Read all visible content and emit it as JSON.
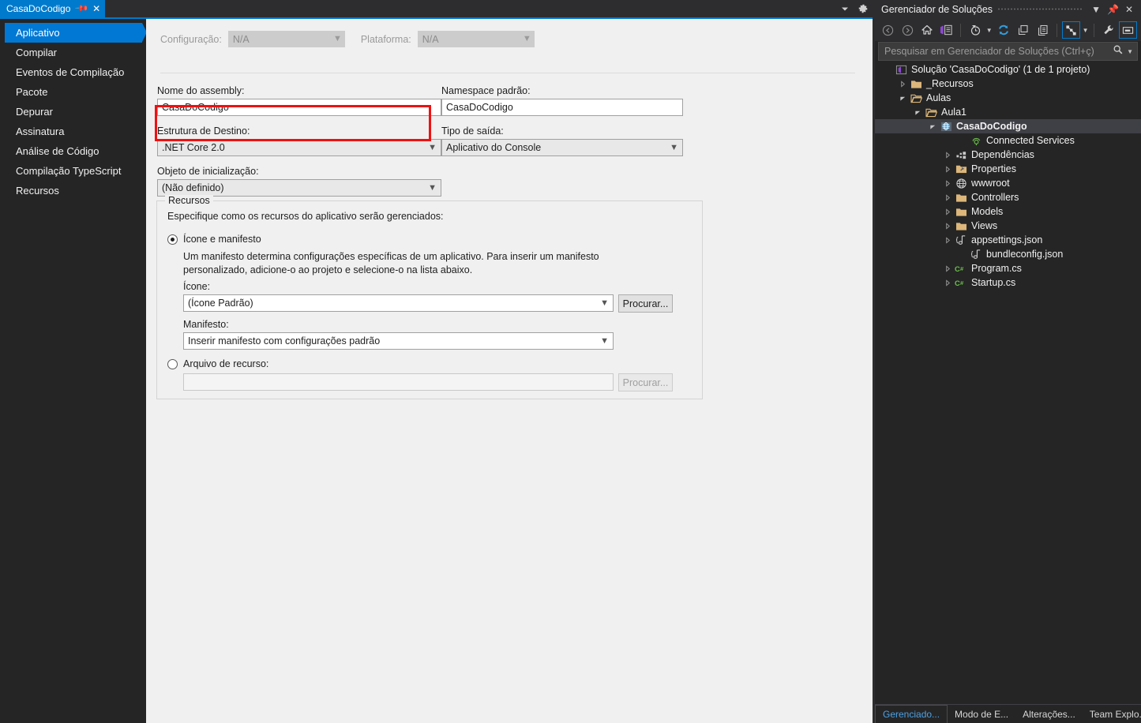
{
  "tab": {
    "label": "CasaDoCodigo",
    "pin_icon": "pin-icon",
    "close_icon": "close-icon",
    "dropdown_icon": "chevron-down-icon",
    "gear_icon": "gear-icon"
  },
  "nav": {
    "items": [
      {
        "label": "Aplicativo",
        "selected": true
      },
      {
        "label": "Compilar",
        "selected": false
      },
      {
        "label": "Eventos de Compilação",
        "selected": false
      },
      {
        "label": "Pacote",
        "selected": false
      },
      {
        "label": "Depurar",
        "selected": false
      },
      {
        "label": "Assinatura",
        "selected": false
      },
      {
        "label": "Análise de Código",
        "selected": false
      },
      {
        "label": "Compilação TypeScript",
        "selected": false
      },
      {
        "label": "Recursos",
        "selected": false
      }
    ]
  },
  "form": {
    "configuration_label": "Configuração:",
    "configuration_value": "N/A",
    "platform_label": "Plataforma:",
    "platform_value": "N/A",
    "assembly_name_label": "Nome do assembly:",
    "assembly_name_value": "CasaDoCodigo",
    "default_namespace_label": "Namespace padrão:",
    "default_namespace_value": "CasaDoCodigo",
    "target_framework_label": "Estrutura de Destino:",
    "target_framework_value": ".NET Core 2.0",
    "output_type_label": "Tipo de saída:",
    "output_type_value": "Aplicativo do Console",
    "startup_object_label": "Objeto de inicialização:",
    "startup_object_value": "(Não definido)",
    "highlight_color": "#ee1111"
  },
  "resources": {
    "group_title": "Recursos",
    "description": "Especifique como os recursos do aplicativo serão gerenciados:",
    "option_icon_manifest": "Ícone e manifesto",
    "option_icon_manifest_selected": true,
    "manifest_help_line1": "Um manifesto determina configurações específicas de um aplicativo. Para inserir um manifesto",
    "manifest_help_line2": "personalizado, adicione-o ao projeto e selecione-o na lista abaixo.",
    "icon_label": "Ícone:",
    "icon_value": "(Ícone Padrão)",
    "icon_browse_button": "Procurar...",
    "manifest_label": "Manifesto:",
    "manifest_value": "Inserir manifesto com configurações padrão",
    "option_resource_file": "Arquivo de recurso:",
    "option_resource_file_selected": false,
    "resource_file_value": "",
    "resource_browse_button": "Procurar..."
  },
  "solution_explorer": {
    "title": "Gerenciador de Soluções",
    "header_buttons": {
      "dropdown_icon": "chevron-down-icon",
      "pin_icon": "pin-icon",
      "close_icon": "close-icon"
    },
    "toolbar_icons": [
      "back-arrow-icon",
      "forward-arrow-icon",
      "home-icon",
      "solution-explorer-view-icon",
      "pending-changes-icon",
      "refresh-icon",
      "collapse-all-icon",
      "show-all-files-icon",
      "properties-icon",
      "preview-selected-items-icon"
    ],
    "search_placeholder": "Pesquisar em Gerenciador de Soluções (Ctrl+ç)",
    "search_icon": "search-icon",
    "tree": [
      {
        "label": "Solução 'CasaDoCodigo' (1 de 1 projeto)",
        "depth": 0,
        "twisty": "none",
        "icon": "visual-studio-solution-icon",
        "selected": false
      },
      {
        "label": "_Recursos",
        "depth": 1,
        "twisty": "collapsed",
        "icon": "folder-icon",
        "selected": false
      },
      {
        "label": "Aulas",
        "depth": 1,
        "twisty": "expanded",
        "icon": "folder-open-icon",
        "selected": false
      },
      {
        "label": "Aula1",
        "depth": 2,
        "twisty": "expanded",
        "icon": "folder-open-icon",
        "selected": false
      },
      {
        "label": "CasaDoCodigo",
        "depth": 3,
        "twisty": "expanded",
        "icon": "web-project-icon",
        "selected": true
      },
      {
        "label": "Connected Services",
        "depth": 5,
        "twisty": "none",
        "icon": "connected-services-icon",
        "selected": false
      },
      {
        "label": "Dependências",
        "depth": 4,
        "twisty": "collapsed",
        "icon": "dependencies-icon",
        "selected": false
      },
      {
        "label": "Properties",
        "depth": 4,
        "twisty": "collapsed",
        "icon": "properties-folder-icon",
        "selected": false
      },
      {
        "label": "wwwroot",
        "depth": 4,
        "twisty": "collapsed",
        "icon": "globe-icon",
        "selected": false
      },
      {
        "label": "Controllers",
        "depth": 4,
        "twisty": "collapsed",
        "icon": "folder-icon",
        "selected": false
      },
      {
        "label": "Models",
        "depth": 4,
        "twisty": "collapsed",
        "icon": "folder-icon",
        "selected": false
      },
      {
        "label": "Views",
        "depth": 4,
        "twisty": "collapsed",
        "icon": "folder-icon",
        "selected": false
      },
      {
        "label": "appsettings.json",
        "depth": 4,
        "twisty": "collapsed",
        "icon": "json-file-icon",
        "selected": false
      },
      {
        "label": "bundleconfig.json",
        "depth": 5,
        "twisty": "none",
        "icon": "json-file-icon",
        "selected": false
      },
      {
        "label": "Program.cs",
        "depth": 4,
        "twisty": "collapsed",
        "icon": "csharp-file-icon",
        "selected": false
      },
      {
        "label": "Startup.cs",
        "depth": 4,
        "twisty": "collapsed",
        "icon": "csharp-file-icon",
        "selected": false
      }
    ],
    "bottom_tabs": [
      {
        "label": "Gerenciado...",
        "active": true
      },
      {
        "label": "Modo de E...",
        "active": false
      },
      {
        "label": "Alterações...",
        "active": false
      },
      {
        "label": "Team Explo...",
        "active": false
      }
    ]
  }
}
